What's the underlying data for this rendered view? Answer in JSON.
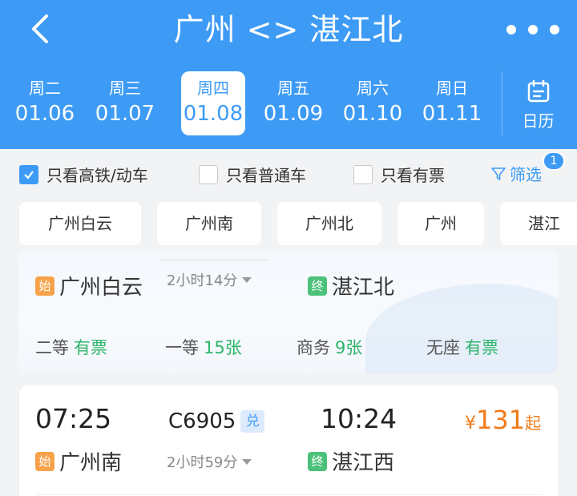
{
  "header": {
    "title": "广州 <> 湛江北",
    "dates": [
      {
        "weekday": "周二",
        "date": "01.06",
        "active": false
      },
      {
        "weekday": "周三",
        "date": "01.07",
        "active": false
      },
      {
        "weekday": "周四",
        "date": "01.08",
        "active": true
      },
      {
        "weekday": "周五",
        "date": "01.09",
        "active": false
      },
      {
        "weekday": "周六",
        "date": "01.10",
        "active": false
      },
      {
        "weekday": "周日",
        "date": "01.11",
        "active": false
      }
    ],
    "calendar_label": "日历",
    "icons": {
      "back": "chevron-left-icon",
      "more": "more-dots-icon",
      "calendar": "calendar-icon"
    }
  },
  "filters": {
    "high_speed": {
      "label": "只看高铁/动车",
      "checked": true
    },
    "regular": {
      "label": "只看普通车",
      "checked": false
    },
    "available": {
      "label": "只看有票",
      "checked": false
    },
    "filter_label": "筛选",
    "filter_badge": "1"
  },
  "stations": [
    "广州白云",
    "广州南",
    "广州北",
    "广州",
    "湛江"
  ],
  "trains": [
    {
      "from": "广州白云",
      "to": "湛江北",
      "duration": "2小时14分",
      "from_tag": "始",
      "to_tag": "终",
      "seats": [
        {
          "class": "二等",
          "avail": "有票"
        },
        {
          "class": "一等",
          "avail": "15张"
        },
        {
          "class": "商务",
          "avail": "9张"
        },
        {
          "class": "无座",
          "avail": "有票"
        }
      ]
    },
    {
      "depart": "07:25",
      "number": "C6905",
      "number_tag": "兑",
      "arrive": "10:24",
      "price_symbol": "¥",
      "price": "131",
      "price_suffix": "起",
      "from": "广州南",
      "to": "湛江西",
      "duration": "2小时59分",
      "from_tag": "始",
      "to_tag": "终"
    }
  ],
  "colors": {
    "primary": "#3d9bf6",
    "price": "#f07b1a",
    "available": "#2fb56b",
    "start_tag": "#f7a24a",
    "end_tag": "#4cc17a"
  }
}
